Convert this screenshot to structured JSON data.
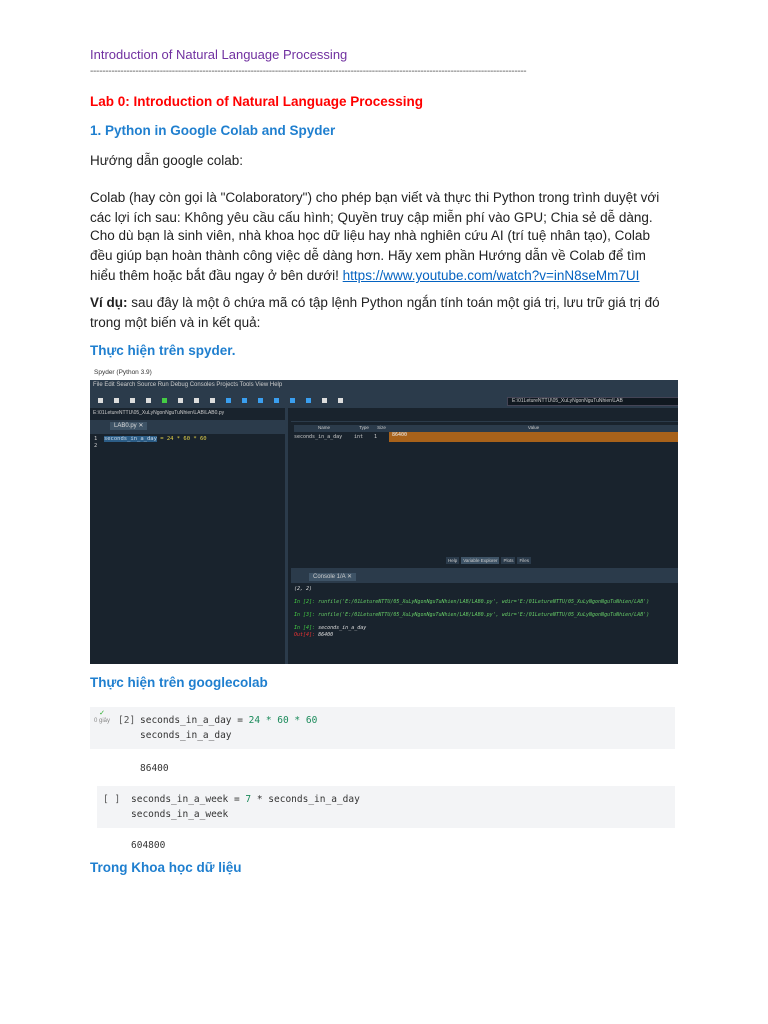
{
  "header": "Introduction of Natural Language Processing",
  "divider": "------------------------------------------------------------------------------------------------------------------------------------------------",
  "lab_title": "Lab 0: Introduction of Natural Language Processing",
  "section1": "1. Python in Google Colab and Spyder",
  "p_guide": "Hướng dẫn google colab:",
  "p_colab": "Colab (hay còn gọi là \"Colaboratory\") cho phép bạn viết và thực thi Python trong trình duyệt với các lợi ích sau:  Không yêu cầu cấu hình; Quyền truy cập miễn phí vào GPU; Chia sẻ dễ dàng.",
  "p_student": "Cho dù bạn là sinh viên, nhà khoa học dữ liệu hay nhà nghiên cứu AI (trí tuệ nhân tạo), Colab đều giúp bạn hoàn thành công việc dễ dàng hơn. Hãy xem phần Hướng dẫn về Colab để tìm hiểu thêm hoặc bắt đầu ngay ở bên dưới! ",
  "link": "https://www.youtube.com/watch?v=inN8seMm7UI",
  "example_label": "Ví dụ:",
  "example_text": " sau đây là một ô chứa mã có tập lệnh Python ngắn tính toán một giá trị, lưu trữ giá trị đó trong một biến và in kết quả:",
  "spyder_heading": "Thực hiện trên spyder.",
  "spyder": {
    "title": "Spyder (Python 3.9)",
    "menu": "File Edit Search Source Run Debug Consoles Projects Tools View Help",
    "wd": "E:\\01LetureNTTU\\05_XuLyNgonNguTuNhien\\LAB",
    "path": "E:\\01LetureNTTU\\05_XuLyNgonNguTuNhien\\LAB\\LAB0.py",
    "editor_tab": "LAB0.py ✕",
    "line1": "1",
    "line2": "2",
    "code_var": "seconds_in_a_day",
    "code_rest": " = 24 * 60 * 60",
    "var_headers": [
      "Name",
      "Type",
      "Size",
      "Value"
    ],
    "var_row": [
      "seconds_in_a_day",
      "int",
      "1",
      "86400"
    ],
    "pane_tabs": [
      "Help",
      "Variable Explorer",
      "Plots",
      "Files"
    ],
    "console_tab": "Console 1/A ✕",
    "console_lines": [
      {
        "p": "",
        "t": "(2, 2)"
      },
      {
        "p": "In [2]: ",
        "t": "runfile('E:/01LetureNTTU/05_XuLyNgonNguTuNhien/LAB/LAB0.py', wdir='E:/01LetureNTTU/05_XuLyNgonNguTuNhien/LAB')"
      },
      {
        "p": "In [3]: ",
        "t": "runfile('E:/01LetureNTTU/05_XuLyNgonNguTuNhien/LAB/LAB0.py', wdir='E:/01LetureNTTU/05_XuLyNgonNguTuNhien/LAB')"
      },
      {
        "p": "In [4]: ",
        "t": "seconds_in_a_day"
      },
      {
        "p": "Out[4]: ",
        "t": "86400"
      }
    ]
  },
  "colab_heading": "Thực hiện trên googlecolab",
  "colab": {
    "cell1": {
      "count": "[2]",
      "status": "0 giây",
      "l1a": "seconds_in_a_day = ",
      "l1b": "24 * 60 * 60",
      "l2": "seconds_in_a_day",
      "out": "86400"
    },
    "cell2": {
      "count": "[ ]",
      "l1a": "seconds_in_a_week = ",
      "l1b": "7",
      "l1c": " * seconds_in_a_day",
      "l2": "seconds_in_a_week",
      "out": "604800"
    }
  },
  "section_ds": "Trong Khoa học dữ liệu"
}
